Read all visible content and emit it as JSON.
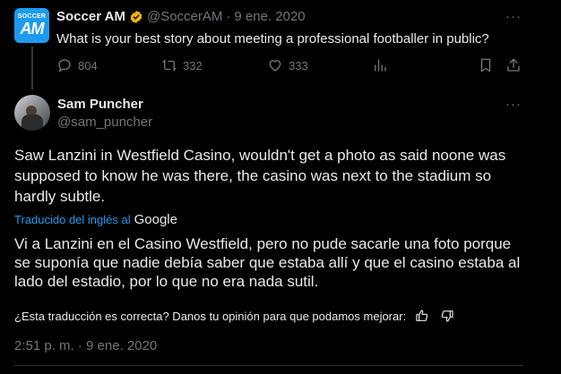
{
  "parent_tweet": {
    "avatar_label": "SOCCER",
    "avatar_mark": "AM",
    "author_name": "Soccer AM",
    "handle": "@SoccerAM",
    "separator": "·",
    "date": "9 ene. 2020",
    "more": "···",
    "text": "What is your best story about meeting a professional footballer in public?",
    "replies": "804",
    "retweets": "332",
    "likes": "333"
  },
  "reply_tweet": {
    "author_name": "Sam Puncher",
    "handle": "@sam_puncher",
    "more": "···",
    "text": "Saw Lanzini in Westfield Casino, wouldn't get a photo as said noone was supposed to know he was there, the casino was next to the stadium so hardly subtle.",
    "translated_from": "Traducido del inglés al",
    "translator": "Google",
    "translation": "Vi a Lanzini en el Casino Westfield, pero no pude sacarle una foto porque se suponía que nadie debía saber que estaba allí y que el casino estaba al lado del estadio, por lo que no era nada sutil.",
    "feedback_prompt": "¿Esta traducción es correcta? Danos tu opinión para que podamos mejorar:",
    "timestamp": "2:51 p. m. · 9 ene. 2020"
  },
  "colors": {
    "background": "#000000",
    "text_primary": "#e7e9ea",
    "text_secondary": "#71767b",
    "accent": "#1d9bf0",
    "verified_badge": "#f2b705"
  }
}
